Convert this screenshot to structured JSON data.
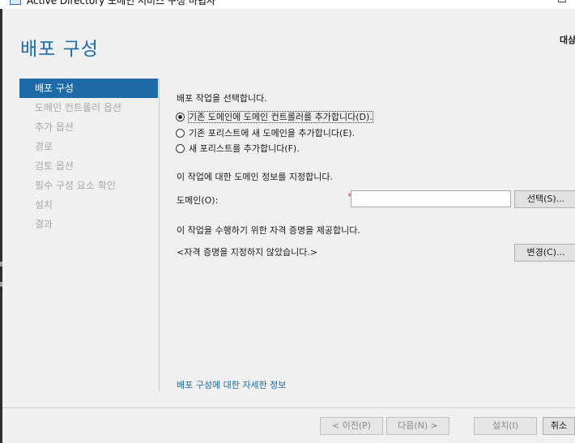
{
  "window": {
    "title": "Active Directory 도메인 서비스 구성 마법사"
  },
  "header": {
    "page_title": "배포 구성",
    "target_server_label": "대상"
  },
  "sidebar": {
    "items": [
      {
        "label": "배포 구성",
        "active": true
      },
      {
        "label": "도메인 컨트롤러 옵션",
        "active": false
      },
      {
        "label": "추가 옵션",
        "active": false
      },
      {
        "label": "경로",
        "active": false
      },
      {
        "label": "검토 옵션",
        "active": false
      },
      {
        "label": "필수 구성 요소 확인",
        "active": false
      },
      {
        "label": "설치",
        "active": false
      },
      {
        "label": "결과",
        "active": false
      }
    ]
  },
  "main": {
    "operation_prompt": "배포 작업을 선택합니다.",
    "operations": [
      {
        "label": "기존 도메인에 도메인 컨트롤러를 추가합니다(D).",
        "selected": true
      },
      {
        "label": "기존 포리스트에 새 도메인을 추가합니다(E).",
        "selected": false
      },
      {
        "label": "새 포리스트를 추가합니다(F).",
        "selected": false
      }
    ],
    "domain_prompt": "이 작업에 대한 도메인 정보를 지정합니다.",
    "domain_label": "도메인(O):",
    "required_marker": "*",
    "domain_value": "",
    "select_button": "선택(S)...",
    "credentials_prompt": "이 작업을 수행하기 위한 자격 증명을 제공합니다.",
    "credentials_status": "<자격 증명을 지정하지 않았습니다.>",
    "change_button": "변경(C)...",
    "more_info_link": "배포 구성에 대한 자세한 정보"
  },
  "footer": {
    "previous_button": "< 이전(P)",
    "next_button": "다음(N) >",
    "install_button": "설치(I)",
    "cancel_button": "취소"
  },
  "colors": {
    "accent": "#1e6aa8",
    "panel_bg": "#f0f0f0",
    "required": "#d43a3a"
  }
}
